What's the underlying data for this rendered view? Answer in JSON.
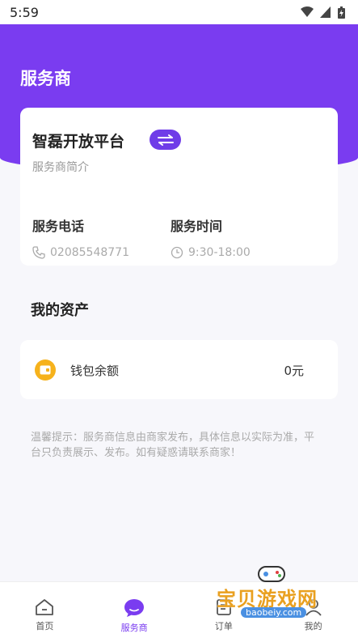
{
  "status_bar": {
    "time": "5:59"
  },
  "header": {
    "title": "服务商"
  },
  "provider": {
    "name": "智磊开放平台",
    "subtitle": "服务商简介",
    "phone_label": "服务电话",
    "phone": "02085548771",
    "hours_label": "服务时间",
    "hours": "9:30-18:00"
  },
  "assets": {
    "title": "我的资产",
    "wallet_label": "钱包余额",
    "wallet_amount": "0元"
  },
  "tip": "温馨提示：服务商信息由商家发布，具体信息以实际为准，平台只负责展示、发布。如有疑惑请联系商家！",
  "tabbar": {
    "items": [
      {
        "label": "首页"
      },
      {
        "label": "服务商"
      },
      {
        "label": "订单"
      },
      {
        "label": "我的"
      }
    ]
  },
  "watermark": {
    "text": "宝贝游戏网",
    "url": "baobeiy.com"
  },
  "colors": {
    "accent": "#7a3cf0",
    "wallet": "#f6b21c"
  }
}
